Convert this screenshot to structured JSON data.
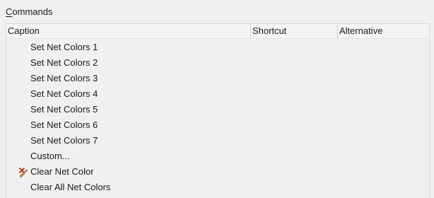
{
  "group": {
    "label_accel": "C",
    "label_rest": "ommands"
  },
  "columns": {
    "caption": "Caption",
    "shortcut": "Shortcut",
    "alternative": "Alternative"
  },
  "rows": [
    {
      "caption": "Set Net Colors 1",
      "shortcut": "",
      "alternative": ""
    },
    {
      "caption": "Set Net Colors 2",
      "shortcut": "",
      "alternative": ""
    },
    {
      "caption": "Set Net Colors 3",
      "shortcut": "",
      "alternative": ""
    },
    {
      "caption": "Set Net Colors 4",
      "shortcut": "",
      "alternative": ""
    },
    {
      "caption": "Set Net Colors 5",
      "shortcut": "",
      "alternative": ""
    },
    {
      "caption": "Set Net Colors 6",
      "shortcut": "",
      "alternative": ""
    },
    {
      "caption": "Set Net Colors 7",
      "shortcut": "",
      "alternative": ""
    },
    {
      "caption": "Custom...",
      "shortcut": "",
      "alternative": ""
    },
    {
      "caption": "Clear Net Color",
      "shortcut": "",
      "alternative": "",
      "icon": "clear-color-icon"
    },
    {
      "caption": "Clear All Net Colors",
      "shortcut": "",
      "alternative": ""
    }
  ]
}
